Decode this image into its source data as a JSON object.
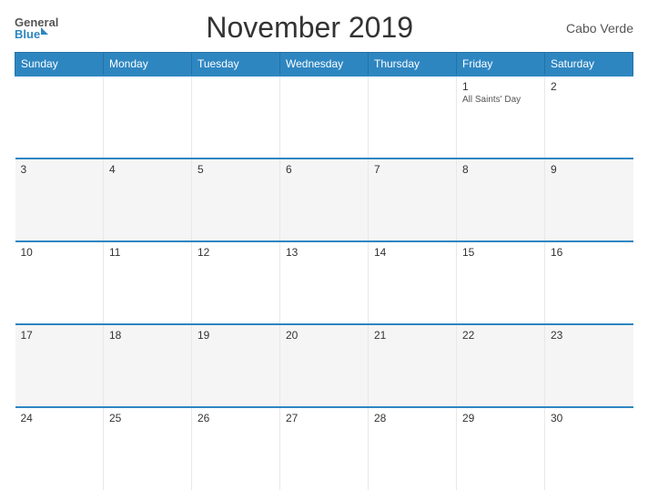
{
  "header": {
    "logo_general": "General",
    "logo_blue": "Blue",
    "title": "November 2019",
    "country": "Cabo Verde"
  },
  "calendar": {
    "weekdays": [
      "Sunday",
      "Monday",
      "Tuesday",
      "Wednesday",
      "Thursday",
      "Friday",
      "Saturday"
    ],
    "weeks": [
      [
        {
          "day": "",
          "holiday": ""
        },
        {
          "day": "",
          "holiday": ""
        },
        {
          "day": "",
          "holiday": ""
        },
        {
          "day": "",
          "holiday": ""
        },
        {
          "day": "",
          "holiday": ""
        },
        {
          "day": "1",
          "holiday": "All Saints' Day"
        },
        {
          "day": "2",
          "holiday": ""
        }
      ],
      [
        {
          "day": "3",
          "holiday": ""
        },
        {
          "day": "4",
          "holiday": ""
        },
        {
          "day": "5",
          "holiday": ""
        },
        {
          "day": "6",
          "holiday": ""
        },
        {
          "day": "7",
          "holiday": ""
        },
        {
          "day": "8",
          "holiday": ""
        },
        {
          "day": "9",
          "holiday": ""
        }
      ],
      [
        {
          "day": "10",
          "holiday": ""
        },
        {
          "day": "11",
          "holiday": ""
        },
        {
          "day": "12",
          "holiday": ""
        },
        {
          "day": "13",
          "holiday": ""
        },
        {
          "day": "14",
          "holiday": ""
        },
        {
          "day": "15",
          "holiday": ""
        },
        {
          "day": "16",
          "holiday": ""
        }
      ],
      [
        {
          "day": "17",
          "holiday": ""
        },
        {
          "day": "18",
          "holiday": ""
        },
        {
          "day": "19",
          "holiday": ""
        },
        {
          "day": "20",
          "holiday": ""
        },
        {
          "day": "21",
          "holiday": ""
        },
        {
          "day": "22",
          "holiday": ""
        },
        {
          "day": "23",
          "holiday": ""
        }
      ],
      [
        {
          "day": "24",
          "holiday": ""
        },
        {
          "day": "25",
          "holiday": ""
        },
        {
          "day": "26",
          "holiday": ""
        },
        {
          "day": "27",
          "holiday": ""
        },
        {
          "day": "28",
          "holiday": ""
        },
        {
          "day": "29",
          "holiday": ""
        },
        {
          "day": "30",
          "holiday": ""
        }
      ]
    ]
  }
}
